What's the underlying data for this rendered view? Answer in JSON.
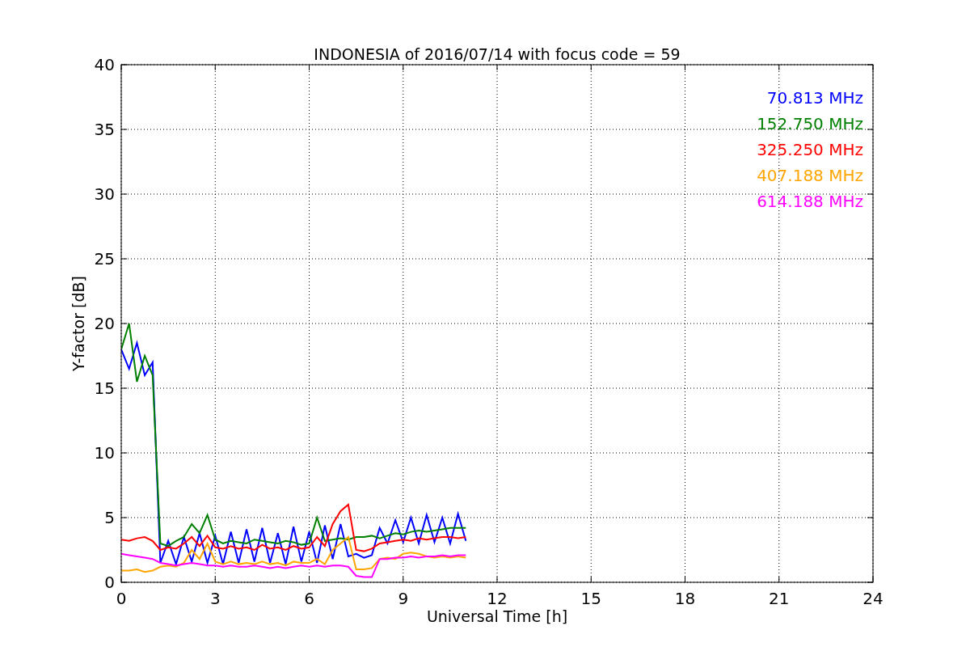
{
  "chart_data": {
    "type": "line",
    "title": "INDONESIA of 2016/07/14 with focus code = 59",
    "xlabel": "Universal Time [h]",
    "ylabel": "Y-factor [dB]",
    "x": [
      0,
      0.25,
      0.5,
      0.75,
      1,
      1.25,
      1.5,
      1.75,
      2,
      2.25,
      2.5,
      2.75,
      3,
      3.25,
      3.5,
      3.75,
      4,
      4.25,
      4.5,
      4.75,
      5,
      5.25,
      5.5,
      5.75,
      6,
      6.25,
      6.5,
      6.75,
      7,
      7.25,
      7.5,
      7.75,
      8,
      8.25,
      8.5,
      8.75,
      9,
      9.25,
      9.5,
      9.75,
      10,
      10.25,
      10.5,
      10.75,
      11
    ],
    "series": [
      {
        "name": "70.813 MHz",
        "color": "#0000ff",
        "values": [
          18,
          16.5,
          18.5,
          16,
          17,
          1.5,
          3.2,
          1.4,
          3.5,
          1.6,
          3.8,
          1.5,
          3.6,
          1.4,
          3.9,
          1.5,
          4.1,
          1.6,
          4.2,
          1.5,
          3.8,
          1.4,
          4.3,
          1.6,
          3.9,
          1.5,
          4.4,
          1.8,
          4.5,
          2.0,
          2.2,
          1.9,
          2.1,
          4.2,
          3.0,
          4.8,
          3.1,
          5.0,
          3.0,
          5.2,
          3.1,
          5.0,
          3.0,
          5.3,
          3.2
        ]
      },
      {
        "name": "152.750 MHz",
        "color": "#008000",
        "values": [
          18,
          20,
          15.5,
          17.5,
          16,
          3.0,
          2.8,
          3.2,
          3.5,
          4.5,
          3.8,
          5.2,
          3.3,
          3.0,
          3.2,
          3.1,
          3.0,
          3.3,
          3.2,
          3.1,
          3.0,
          3.2,
          3.1,
          2.9,
          3.0,
          5.0,
          3.2,
          3.3,
          3.4,
          3.3,
          3.5,
          3.5,
          3.6,
          3.4,
          3.6,
          3.8,
          3.7,
          3.9,
          4.0,
          3.9,
          4.0,
          4.1,
          4.2,
          4.2,
          4.2
        ]
      },
      {
        "name": "325.250 MHz",
        "color": "#ff0000",
        "values": [
          3.3,
          3.2,
          3.4,
          3.5,
          3.2,
          2.5,
          2.7,
          2.6,
          3.0,
          3.5,
          2.8,
          3.6,
          2.7,
          2.6,
          2.8,
          2.6,
          2.7,
          2.5,
          2.9,
          2.6,
          2.7,
          2.5,
          2.8,
          2.6,
          2.7,
          3.5,
          2.8,
          4.5,
          5.5,
          6.0,
          2.5,
          2.4,
          2.6,
          3.0,
          3.1,
          3.2,
          3.3,
          3.2,
          3.4,
          3.3,
          3.4,
          3.5,
          3.5,
          3.4,
          3.5
        ]
      },
      {
        "name": "407.188 MHz",
        "color": "#ffa500",
        "values": [
          0.9,
          0.9,
          1.0,
          0.8,
          0.9,
          1.2,
          1.3,
          1.2,
          1.5,
          2.5,
          1.8,
          3.0,
          1.6,
          1.4,
          1.6,
          1.4,
          1.5,
          1.4,
          1.6,
          1.4,
          1.5,
          1.3,
          1.6,
          1.5,
          1.5,
          1.8,
          1.4,
          2.5,
          3.0,
          3.5,
          1.0,
          1.0,
          1.1,
          1.8,
          1.9,
          1.8,
          2.2,
          2.3,
          2.2,
          2.0,
          1.9,
          2.0,
          1.9,
          2.0,
          1.9
        ]
      },
      {
        "name": "614.188 MHz",
        "color": "#ff00ff",
        "values": [
          2.2,
          2.1,
          2.0,
          1.9,
          1.8,
          1.5,
          1.4,
          1.3,
          1.4,
          1.5,
          1.4,
          1.3,
          1.3,
          1.2,
          1.3,
          1.2,
          1.2,
          1.3,
          1.2,
          1.1,
          1.2,
          1.1,
          1.2,
          1.3,
          1.2,
          1.3,
          1.2,
          1.3,
          1.3,
          1.2,
          0.5,
          0.4,
          0.4,
          1.8,
          1.8,
          1.9,
          1.9,
          2.0,
          1.9,
          2.0,
          2.0,
          2.1,
          2.0,
          2.1,
          2.1
        ]
      }
    ],
    "grid": true,
    "xlim": [
      0,
      24
    ],
    "ylim": [
      0,
      40
    ],
    "xticks": [
      0,
      3,
      6,
      9,
      12,
      15,
      18,
      21,
      24
    ],
    "yticks": [
      0,
      5,
      10,
      15,
      20,
      25,
      30,
      35,
      40
    ]
  }
}
